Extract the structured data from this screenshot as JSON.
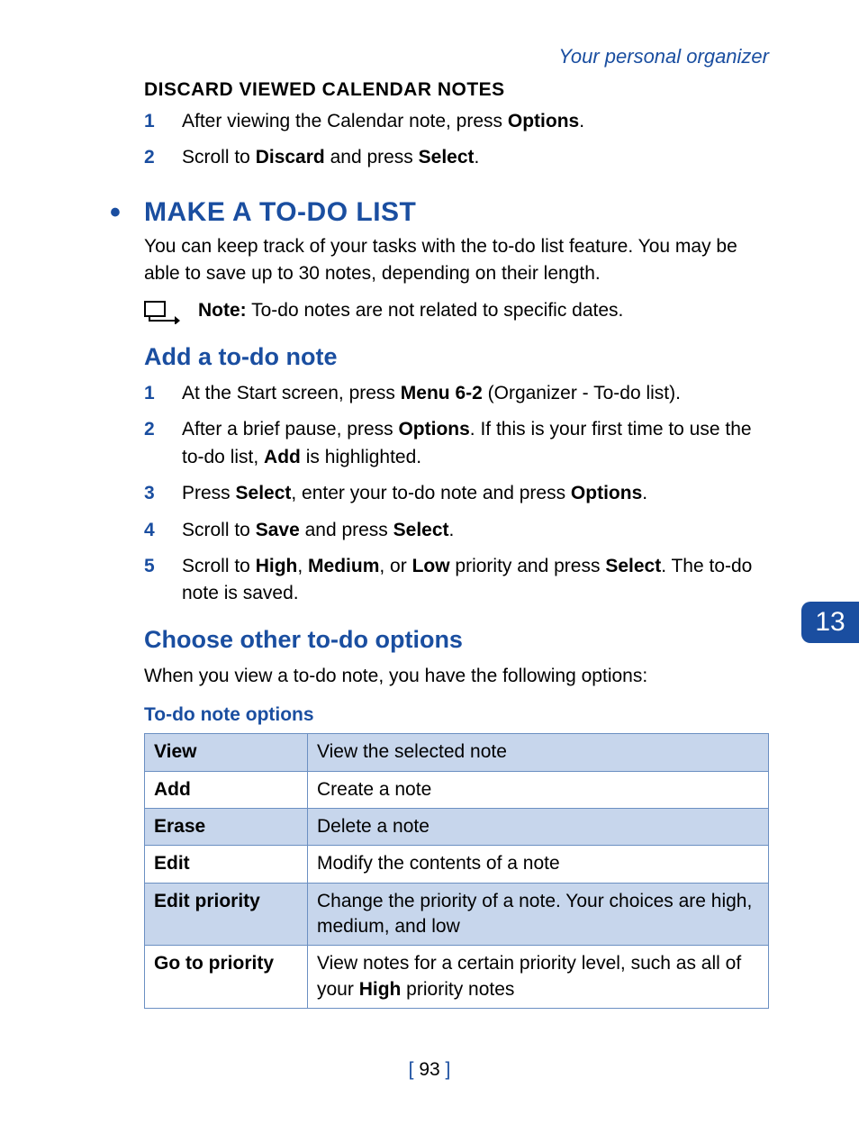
{
  "header": {
    "section": "Your personal organizer"
  },
  "discard": {
    "heading": "DISCARD VIEWED CALENDAR NOTES",
    "steps": [
      {
        "pre": "After viewing the Calendar note, press ",
        "b1": "Options",
        "post": "."
      },
      {
        "pre": "Scroll to ",
        "b1": "Discard",
        "mid": " and press ",
        "b2": "Select",
        "post": "."
      }
    ]
  },
  "main": {
    "heading": "MAKE A TO-DO LIST",
    "intro": "You can keep track of your tasks with the to-do list feature. You may be able to save up to 30 notes, depending on their length.",
    "note_label": "Note:",
    "note_text": " To-do notes are not related to specific dates."
  },
  "add": {
    "heading": "Add a to-do note",
    "steps": {
      "s1": {
        "pre": "At the Start screen, press ",
        "b1": "Menu 6-2",
        "post": " (Organizer - To-do list)."
      },
      "s2": {
        "pre": "After a brief pause, press ",
        "b1": "Options",
        "mid": ". If this is your first time to use the to-do list, ",
        "b2": "Add",
        "post": " is highlighted."
      },
      "s3": {
        "pre": "Press ",
        "b1": "Select",
        "mid": ", enter your to-do note and press ",
        "b2": "Options",
        "post": "."
      },
      "s4": {
        "pre": "Scroll to ",
        "b1": "Save",
        "mid": " and press ",
        "b2": "Select",
        "post": "."
      },
      "s5": {
        "pre": "Scroll to ",
        "b1": "High",
        "c1": ", ",
        "b2": "Medium",
        "c2": ", or ",
        "b3": "Low",
        "mid": " priority and press ",
        "b4": "Select",
        "post": ". The to-do note is saved."
      }
    }
  },
  "choose": {
    "heading": "Choose other to-do options",
    "intro": "When you view a to-do note, you have the following options:",
    "table_caption": "To-do note options",
    "rows": [
      {
        "k": "View",
        "v": "View the selected note"
      },
      {
        "k": "Add",
        "v": "Create a note"
      },
      {
        "k": "Erase",
        "v": "Delete a note"
      },
      {
        "k": "Edit",
        "v": "Modify the contents of a note"
      },
      {
        "k": "Edit priority",
        "v": "Change the priority of a note. Your choices are high, medium, and low"
      },
      {
        "k": "Go to priority",
        "v_pre": "View notes for a certain priority level, such as all of your ",
        "v_b": "High",
        "v_post": " priority notes"
      }
    ]
  },
  "chapter": "13",
  "page": "93"
}
